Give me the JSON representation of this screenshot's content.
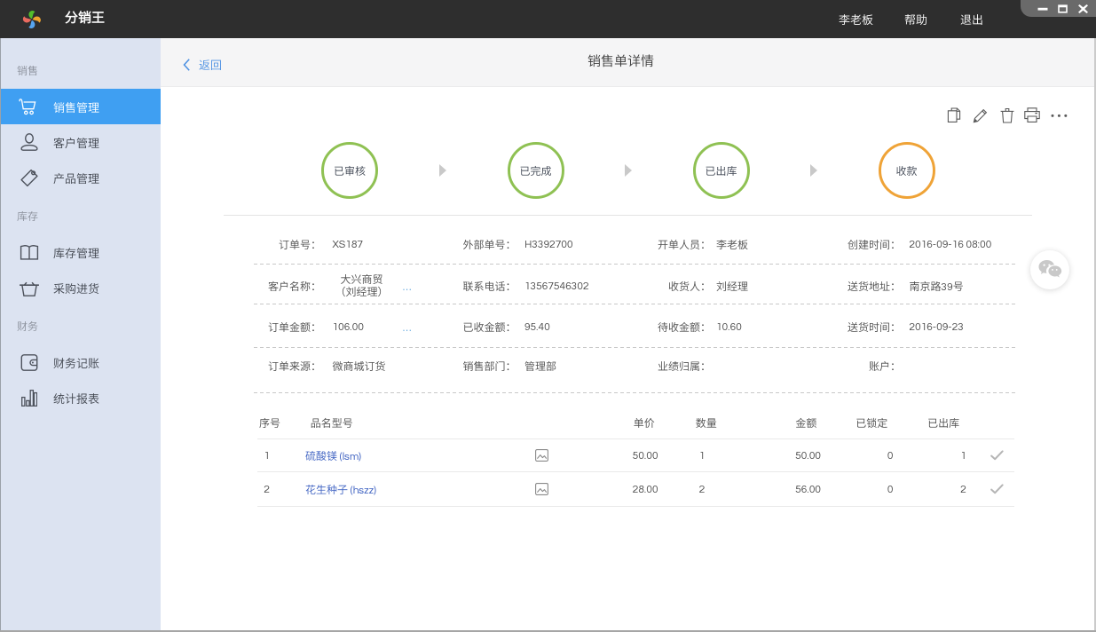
{
  "window": {
    "title": "分销王",
    "user": "李老板",
    "menu": {
      "help": "帮助",
      "logout": "退出"
    }
  },
  "sidebar": {
    "sections": [
      {
        "label": "销售",
        "items": [
          {
            "label": "销售管理",
            "icon": "cart-icon",
            "active": true
          },
          {
            "label": "客户管理",
            "icon": "person-icon",
            "active": false
          },
          {
            "label": "产品管理",
            "icon": "tag-icon",
            "active": false
          }
        ]
      },
      {
        "label": "库存",
        "items": [
          {
            "label": "库存管理",
            "icon": "book-icon",
            "active": false
          },
          {
            "label": "采购进货",
            "icon": "basket-icon",
            "active": false
          }
        ]
      },
      {
        "label": "财务",
        "items": [
          {
            "label": "财务记账",
            "icon": "wallet-icon",
            "active": false
          },
          {
            "label": "统计报表",
            "icon": "chart-icon",
            "active": false
          }
        ]
      }
    ]
  },
  "header": {
    "back": "返回",
    "title": "销售单详情"
  },
  "toolbar": {
    "icons": [
      "copy-icon",
      "edit-icon",
      "delete-icon",
      "print-icon",
      "more-icon"
    ]
  },
  "status_flow": {
    "steps": [
      {
        "label": "已审核",
        "color": "#8fc153"
      },
      {
        "label": "已完成",
        "color": "#8fc153"
      },
      {
        "label": "已出库",
        "color": "#8fc153"
      },
      {
        "label": "收款",
        "color": "#efa337"
      }
    ]
  },
  "order": {
    "order_no_label": "订单号：",
    "order_no": "XS187",
    "ext_no_label": "外部单号：",
    "ext_no": "H3392700",
    "creator_label": "开单人员：",
    "creator": "李老板",
    "created_label": "创建时间：",
    "created": "2016-09-16 08:00",
    "customer_label": "客户名称：",
    "customer_line1": "大兴商贸",
    "customer_line2": "（刘经理）",
    "phone_label": "联系电话：",
    "phone": "13567546302",
    "consignee_label": "收货人：",
    "consignee": "刘经理",
    "address_label": "送货地址：",
    "address": "南京路39号",
    "amount_label": "订单金额：",
    "amount": "106.00",
    "received_label": "已收金额：",
    "received": "95.40",
    "pending_label": "待收金额：",
    "pending": "10.60",
    "delivery_label": "送货时间：",
    "delivery": "2016-09-23",
    "source_label": "订单来源：",
    "source": "微商城订货",
    "dept_label": "销售部门：",
    "dept": "管理部",
    "perf_label": "业绩归属：",
    "perf": "",
    "account_label": "账户：",
    "account": "",
    "more_dots": "..."
  },
  "products": {
    "headers": {
      "seq": "序号",
      "name": "品名型号",
      "price": "单价",
      "qty": "数量",
      "amount": "金额",
      "locked": "已锁定",
      "shipped": "已出库"
    },
    "rows": [
      {
        "seq": "1",
        "name": "硫酸镁 (lsm)",
        "price": "50.00",
        "qty": "1",
        "amount": "50.00",
        "locked": "0",
        "shipped": "1"
      },
      {
        "seq": "2",
        "name": "花生种子 (hszz)",
        "price": "28.00",
        "qty": "2",
        "amount": "56.00",
        "locked": "0",
        "shipped": "2"
      }
    ]
  }
}
